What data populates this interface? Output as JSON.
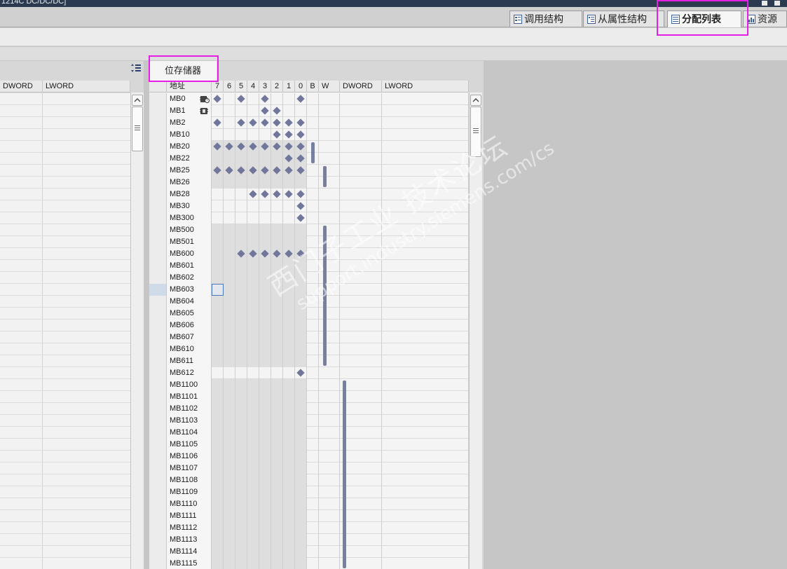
{
  "window": {
    "title_fragment": "1214C DC/DC/DC]"
  },
  "tabs": [
    {
      "label": "调用结构",
      "active": false
    },
    {
      "label": "从属性结构",
      "active": false
    },
    {
      "label": "分配列表",
      "active": true
    },
    {
      "label": "资源",
      "active": false
    }
  ],
  "left_table": {
    "columns": [
      "DWORD",
      "LWORD"
    ]
  },
  "bit_memory": {
    "tab_label": "位存储器",
    "columns": {
      "address": "地址",
      "bits": [
        "7",
        "6",
        "5",
        "4",
        "3",
        "2",
        "1",
        "0"
      ],
      "b": "B",
      "w": "W",
      "dword": "DWORD",
      "lword": "LWORD"
    },
    "rows": [
      {
        "addr": "MB0",
        "bits": [
          7,
          5,
          3,
          0
        ],
        "shade": false,
        "icon": "clock-memory-icon"
      },
      {
        "addr": "MB1",
        "bits": [
          3,
          2
        ],
        "shade": false,
        "icon": "system-memory-icon"
      },
      {
        "addr": "MB2",
        "bits": [
          7,
          5,
          4,
          3,
          2,
          1,
          0
        ],
        "shade": false
      },
      {
        "addr": "MB10",
        "bits": [
          2,
          1,
          0
        ],
        "shade": false
      },
      {
        "addr": "MB20",
        "bits": [
          7,
          6,
          5,
          4,
          3,
          2,
          1,
          0
        ],
        "shade": true
      },
      {
        "addr": "MB22",
        "bits": [
          1,
          0
        ],
        "shade": true
      },
      {
        "addr": "MB25",
        "bits": [
          7,
          6,
          5,
          4,
          3,
          2,
          1,
          0
        ],
        "shade": true
      },
      {
        "addr": "MB26",
        "bits": [],
        "shade": true
      },
      {
        "addr": "MB28",
        "bits": [
          4,
          3,
          2,
          1,
          0
        ],
        "shade": false
      },
      {
        "addr": "MB30",
        "bits": [
          0
        ],
        "shade": false
      },
      {
        "addr": "MB300",
        "bits": [
          0
        ],
        "shade": false
      },
      {
        "addr": "MB500",
        "bits": [],
        "shade": true
      },
      {
        "addr": "MB501",
        "bits": [],
        "shade": true
      },
      {
        "addr": "MB600",
        "bits": [
          5,
          4,
          3,
          2,
          1,
          0
        ],
        "shade": true
      },
      {
        "addr": "MB601",
        "bits": [],
        "shade": true
      },
      {
        "addr": "MB602",
        "bits": [],
        "shade": true
      },
      {
        "addr": "MB603",
        "bits": [],
        "shade": true,
        "focus_bit": 7
      },
      {
        "addr": "MB604",
        "bits": [],
        "shade": true
      },
      {
        "addr": "MB605",
        "bits": [],
        "shade": true
      },
      {
        "addr": "MB606",
        "bits": [],
        "shade": true
      },
      {
        "addr": "MB607",
        "bits": [],
        "shade": true
      },
      {
        "addr": "MB610",
        "bits": [],
        "shade": true
      },
      {
        "addr": "MB611",
        "bits": [],
        "shade": true
      },
      {
        "addr": "MB612",
        "bits": [
          0
        ],
        "shade": false
      },
      {
        "addr": "MB1100",
        "bits": [],
        "shade": true
      },
      {
        "addr": "MB1101",
        "bits": [],
        "shade": true
      },
      {
        "addr": "MB1102",
        "bits": [],
        "shade": true
      },
      {
        "addr": "MB1103",
        "bits": [],
        "shade": true
      },
      {
        "addr": "MB1104",
        "bits": [],
        "shade": true
      },
      {
        "addr": "MB1105",
        "bits": [],
        "shade": true
      },
      {
        "addr": "MB1106",
        "bits": [],
        "shade": true
      },
      {
        "addr": "MB1107",
        "bits": [],
        "shade": true
      },
      {
        "addr": "MB1108",
        "bits": [],
        "shade": true
      },
      {
        "addr": "MB1109",
        "bits": [],
        "shade": true
      },
      {
        "addr": "MB1110",
        "bits": [],
        "shade": true
      },
      {
        "addr": "MB1111",
        "bits": [],
        "shade": true
      },
      {
        "addr": "MB1112",
        "bits": [],
        "shade": true
      },
      {
        "addr": "MB1113",
        "bits": [],
        "shade": true
      },
      {
        "addr": "MB1114",
        "bits": [],
        "shade": true
      },
      {
        "addr": "MB1115",
        "bits": [],
        "shade": true
      }
    ],
    "usage_bars": [
      {
        "column": "B",
        "from_row": 4,
        "to_row": 5
      },
      {
        "column": "W",
        "from_row": 6,
        "to_row": 7
      },
      {
        "column": "W",
        "from_row": 11,
        "to_row": 22
      },
      {
        "column": "DWORD",
        "from_row": 24,
        "to_row": 39
      }
    ]
  },
  "watermark": {
    "line1": "西门子工业 技术论坛",
    "line2": "support.industry.siemens.com/cs"
  },
  "colors": {
    "marker": "#70779a",
    "highlight_frame": "#e61ee6",
    "title_bar": "#2b3a4f"
  }
}
